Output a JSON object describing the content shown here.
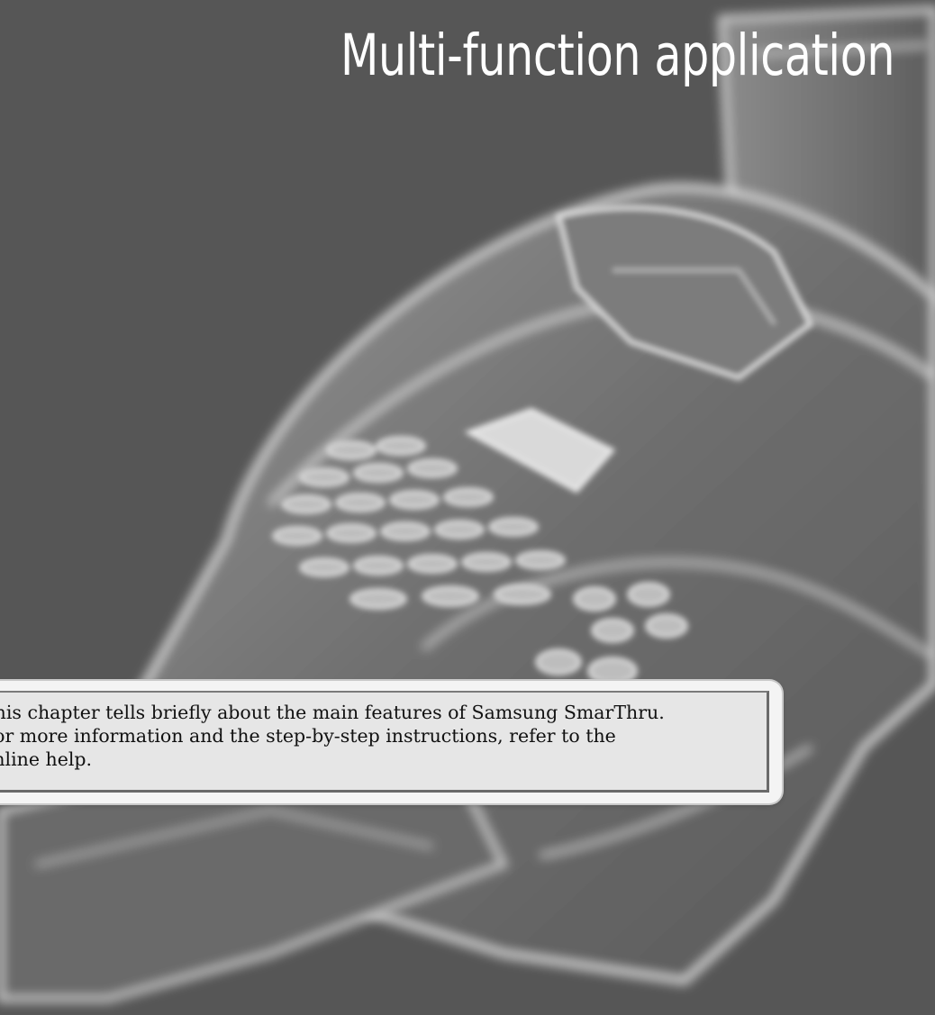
{
  "chapter": {
    "title": "Multi-function application"
  },
  "summary": {
    "lines": [
      "This chapter tells briefly about the main features of Samsung SmarThru.",
      "For more information and the step-by-step instructions, refer to the",
      "online help."
    ]
  },
  "colors": {
    "background": "#565656",
    "title": "#ffffff",
    "box_fill": "#e6e6e6",
    "text": "#111111"
  }
}
